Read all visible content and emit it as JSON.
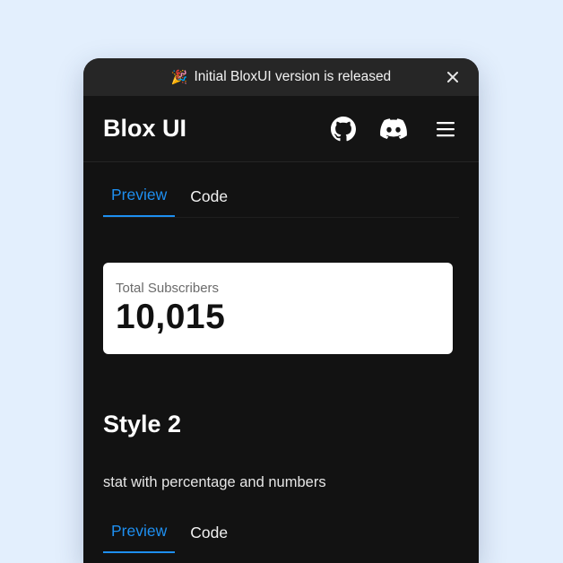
{
  "banner": {
    "emoji": "🎉",
    "text": "Initial BloxUI version is released"
  },
  "header": {
    "logo": "Blox UI",
    "icons": [
      "github-icon",
      "discord-icon",
      "menu-icon"
    ]
  },
  "tabs": [
    {
      "label": "Preview",
      "active": true
    },
    {
      "label": "Code",
      "active": false
    }
  ],
  "stat": {
    "label": "Total Subscribers",
    "value": "10,015"
  },
  "section": {
    "title": "Style 2",
    "description": "stat with percentage and numbers"
  },
  "tabs2": [
    {
      "label": "Preview",
      "active": true
    },
    {
      "label": "Code",
      "active": false
    }
  ],
  "colors": {
    "background": "#e3effd",
    "device": "#121212",
    "banner": "#262626",
    "accent": "#1e8ff0",
    "card": "#ffffff"
  }
}
